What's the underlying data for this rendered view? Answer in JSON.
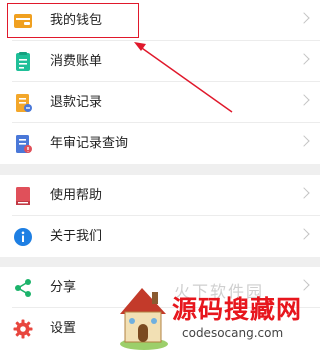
{
  "menu": {
    "group1": [
      {
        "label": "我的钱包",
        "icon": "wallet-icon",
        "color": "#f0a020"
      },
      {
        "label": "消费账单",
        "icon": "bill-icon",
        "color": "#1fbf98"
      },
      {
        "label": "退款记录",
        "icon": "refund-icon",
        "color": "#f3a72a"
      },
      {
        "label": "年审记录查询",
        "icon": "inspection-record-icon",
        "color": "#4a78d8"
      }
    ],
    "group2": [
      {
        "label": "使用帮助",
        "icon": "help-book-icon",
        "color": "#e0505a"
      },
      {
        "label": "关于我们",
        "icon": "info-icon",
        "color": "#1e7fe3"
      }
    ],
    "group3": [
      {
        "label": "分享",
        "icon": "share-icon",
        "color": "#1cb36b"
      },
      {
        "label": "设置",
        "icon": "settings-gear-icon",
        "color": "#e8463e"
      }
    ]
  },
  "watermark": {
    "title": "源码搜藏网",
    "url": "codesocang.com",
    "gray_text": "火下软件园"
  },
  "annotation_color": "#e0182b"
}
